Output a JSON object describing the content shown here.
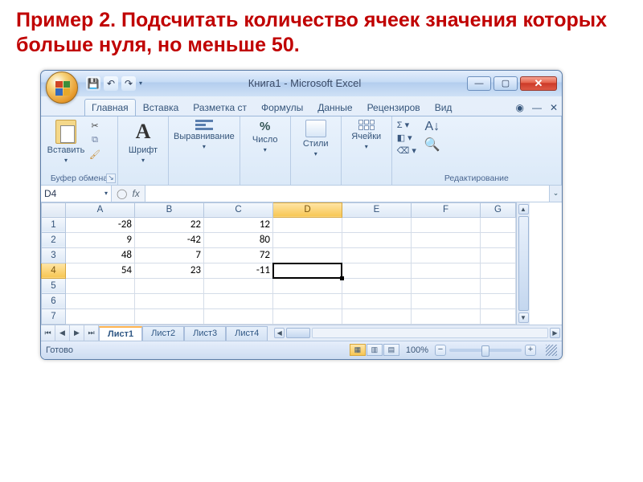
{
  "task": "Пример 2. Подсчитать количество ячеек значения которых больше нуля, но меньше 50.",
  "window": {
    "title": "Книга1 - Microsoft Excel",
    "min_tip": "Свернуть",
    "max_tip": "Развернуть",
    "close_tip": "Закрыть"
  },
  "tabs": {
    "home": "Главная",
    "insert": "Вставка",
    "layout": "Разметка ст",
    "formulas": "Формулы",
    "data": "Данные",
    "review": "Рецензиров",
    "view": "Вид"
  },
  "ribbon": {
    "clipboard": {
      "title": "Буфер обмена",
      "paste": "Вставить"
    },
    "font": {
      "title": "Шрифт"
    },
    "align": {
      "title": "Выравнивание"
    },
    "number": {
      "title": "Число",
      "icon": "%"
    },
    "styles": {
      "title": "Стили"
    },
    "cells": {
      "title": "Ячейки"
    },
    "editing": {
      "title": "Редактирование",
      "sigma": "Σ ▾",
      "fill": "◧ ▾",
      "clear": "⌫ ▾"
    }
  },
  "fx": {
    "namebox": "D4",
    "fx_label": "fx",
    "formula": ""
  },
  "columns": [
    "A",
    "B",
    "C",
    "D",
    "E",
    "F",
    "G"
  ],
  "rows": [
    "1",
    "2",
    "3",
    "4",
    "5",
    "6",
    "7"
  ],
  "selected": {
    "col": "D",
    "row": "4"
  },
  "chart_data": {
    "type": "table",
    "columns": [
      "A",
      "B",
      "C"
    ],
    "rows": [
      {
        "A": -28,
        "B": 22,
        "C": 12
      },
      {
        "A": 9,
        "B": -42,
        "C": 80
      },
      {
        "A": 48,
        "B": 7,
        "C": 72
      },
      {
        "A": 54,
        "B": 23,
        "C": -11
      }
    ]
  },
  "cells": {
    "r1": {
      "A": "-28",
      "B": "22",
      "C": "12"
    },
    "r2": {
      "A": "9",
      "B": "-42",
      "C": "80"
    },
    "r3": {
      "A": "48",
      "B": "7",
      "C": "72"
    },
    "r4": {
      "A": "54",
      "B": "23",
      "C": "-11"
    }
  },
  "sheets": {
    "s1": "Лист1",
    "s2": "Лист2",
    "s3": "Лист3",
    "s4": "Лист4"
  },
  "status": {
    "ready": "Готово",
    "zoom": "100%"
  }
}
